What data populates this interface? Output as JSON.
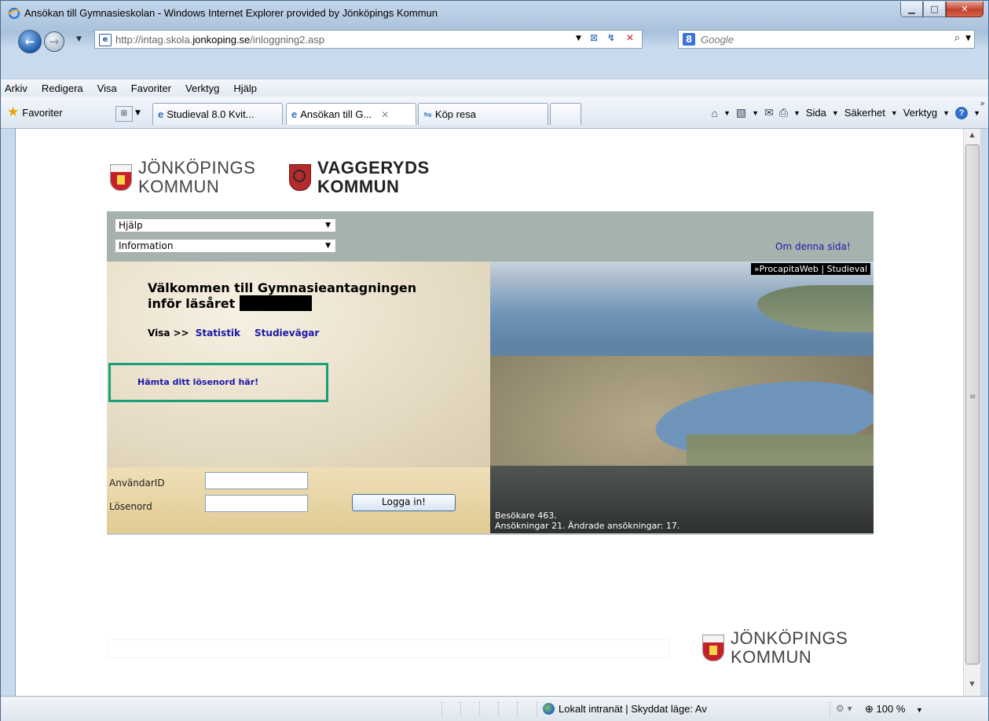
{
  "window": {
    "title": "Ansökan till Gymnasieskolan - Windows Internet Explorer provided by Jönköpings Kommun"
  },
  "address": {
    "url_prefix": "http://intag.skola.",
    "url_host": "jonkoping.se",
    "url_path": "/inloggning2.asp"
  },
  "search": {
    "placeholder": "Google"
  },
  "menu": [
    "Arkiv",
    "Redigera",
    "Visa",
    "Favoriter",
    "Verktyg",
    "Hjälp"
  ],
  "favbar": {
    "favorites_label": "Favoriter"
  },
  "tabs": [
    {
      "label": "Studieval 8.0 Kvit..."
    },
    {
      "label": "Ansökan till G..."
    },
    {
      "label": "Köp resa"
    }
  ],
  "commandbar": {
    "page": "Sida",
    "safety": "Säkerhet",
    "tools": "Verktyg"
  },
  "page": {
    "logo_jk_line1": "JÖNKÖPINGS",
    "logo_jk_line2": "KOMMUN",
    "logo_vg_line1": "VAGGERYDS",
    "logo_vg_line2": "KOMMUN",
    "select_help": "Hjälp",
    "select_info": "Information",
    "about_link": "Om denna sida!",
    "welcome_line1": "Välkommen till Gymnasieantagningen",
    "welcome_line2": "inför läsåret",
    "visa_label": "Visa >>",
    "stat_link": "Statistik",
    "paths_link": "Studievägar",
    "password_link": "Hämta ditt lösenord här!",
    "userid_label": "AnvändarID",
    "password_label": "Lösenord",
    "login_button": "Logga in!",
    "photo_header": "»ProcapitaWeb | Studieval",
    "visitors": "Besökare 463.",
    "applications": "Ansökningar 21. Ändrade ansökningar: 17.",
    "footer_logo_line1": "JÖNKÖPINGS",
    "footer_logo_line2": "KOMMUN"
  },
  "status": {
    "zone": "Lokalt intranät | Skyddat läge: Av",
    "zoom": "100 %"
  }
}
